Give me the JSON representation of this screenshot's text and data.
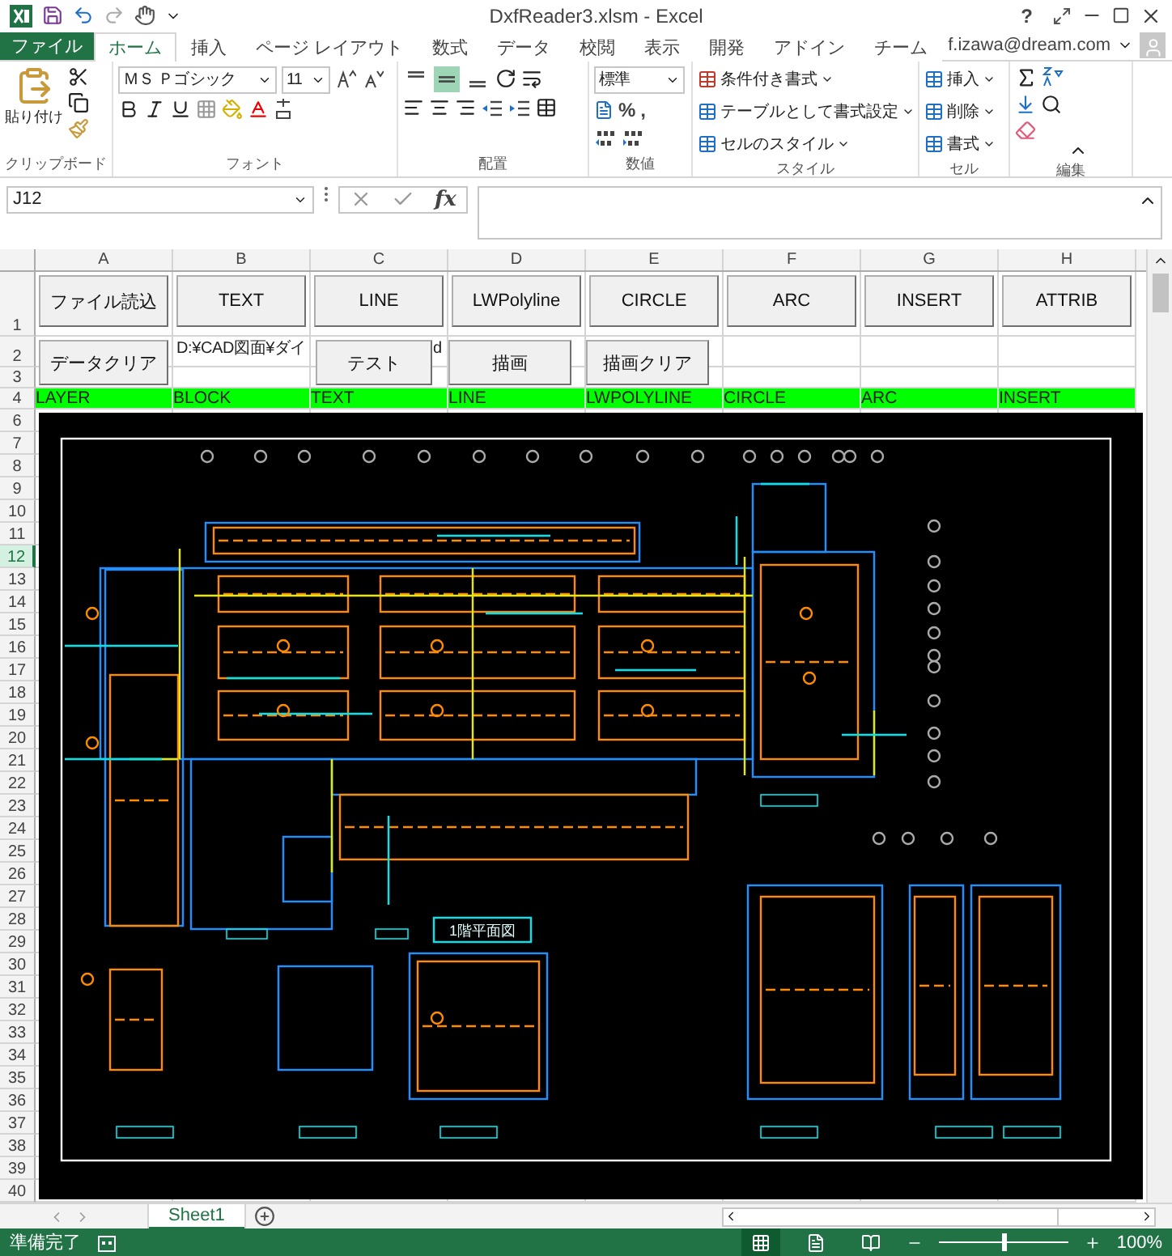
{
  "window": {
    "title": "DxfReader3.xlsm - Excel",
    "help": "?"
  },
  "ribbon_tabs": [
    {
      "label": "ファイル",
      "kind": "file",
      "selected": false
    },
    {
      "label": "ホーム",
      "kind": "tab",
      "selected": true
    },
    {
      "label": "挿入",
      "kind": "tab",
      "selected": false
    },
    {
      "label": "ページ レイアウト",
      "kind": "tab",
      "selected": false
    },
    {
      "label": "数式",
      "kind": "tab",
      "selected": false
    },
    {
      "label": "データ",
      "kind": "tab",
      "selected": false
    },
    {
      "label": "校閲",
      "kind": "tab",
      "selected": false
    },
    {
      "label": "表示",
      "kind": "tab",
      "selected": false
    },
    {
      "label": "開発",
      "kind": "tab",
      "selected": false
    },
    {
      "label": "アドイン",
      "kind": "tab",
      "selected": false
    },
    {
      "label": "チーム",
      "kind": "tab",
      "selected": false
    }
  ],
  "account": {
    "user": "f.izawa@dream.com"
  },
  "ribbon": {
    "clipboard": {
      "paste": "貼り付け",
      "label": "クリップボード"
    },
    "font": {
      "name": "ＭＳ Ｐゴシック",
      "size": "11",
      "label": "フォント"
    },
    "alignment": {
      "vertical": [
        {
          "selected": false
        },
        {
          "selected": true
        },
        {
          "selected": false
        }
      ],
      "label": "配置"
    },
    "number": {
      "format": "標準",
      "percent": "%",
      "comma": ",",
      "label": "数値"
    },
    "styles": {
      "items": [
        "条件付き書式",
        "テーブルとして書式設定",
        "セルのスタイル"
      ],
      "label": "スタイル"
    },
    "cells": {
      "items": [
        "挿入",
        "削除",
        "書式"
      ],
      "label": "セル"
    },
    "editing": {
      "label": "編集"
    }
  },
  "formula_bar": {
    "name_box": "J12",
    "function_glyph": "fx"
  },
  "sheet": {
    "columns": [
      {
        "label": "A",
        "selected": false
      },
      {
        "label": "B",
        "selected": false
      },
      {
        "label": "C",
        "selected": false
      },
      {
        "label": "D",
        "selected": false
      },
      {
        "label": "E",
        "selected": false
      },
      {
        "label": "F",
        "selected": false
      },
      {
        "label": "G",
        "selected": false
      },
      {
        "label": "H",
        "selected": false
      }
    ],
    "rows": [
      {
        "label": "1",
        "selected": false
      },
      {
        "label": "2",
        "selected": false
      },
      {
        "label": "3",
        "selected": false
      },
      {
        "label": "4",
        "selected": false
      },
      {
        "label": "6",
        "selected": false
      },
      {
        "label": "7",
        "selected": false
      },
      {
        "label": "8",
        "selected": false
      },
      {
        "label": "9",
        "selected": false
      },
      {
        "label": "10",
        "selected": false
      },
      {
        "label": "11",
        "selected": false
      },
      {
        "label": "12",
        "selected": true
      },
      {
        "label": "13",
        "selected": false
      },
      {
        "label": "14",
        "selected": false
      },
      {
        "label": "15",
        "selected": false
      },
      {
        "label": "16",
        "selected": false
      },
      {
        "label": "17",
        "selected": false
      },
      {
        "label": "18",
        "selected": false
      },
      {
        "label": "19",
        "selected": false
      },
      {
        "label": "20",
        "selected": false
      },
      {
        "label": "21",
        "selected": false
      },
      {
        "label": "22",
        "selected": false
      },
      {
        "label": "23",
        "selected": false
      },
      {
        "label": "24",
        "selected": false
      },
      {
        "label": "25",
        "selected": false
      },
      {
        "label": "26",
        "selected": false
      },
      {
        "label": "27",
        "selected": false
      },
      {
        "label": "28",
        "selected": false
      },
      {
        "label": "29",
        "selected": false
      },
      {
        "label": "30",
        "selected": false
      },
      {
        "label": "31",
        "selected": false
      },
      {
        "label": "32",
        "selected": false
      },
      {
        "label": "33",
        "selected": false
      },
      {
        "label": "34",
        "selected": false
      },
      {
        "label": "35",
        "selected": false
      },
      {
        "label": "36",
        "selected": false
      },
      {
        "label": "37",
        "selected": false
      },
      {
        "label": "38",
        "selected": false
      },
      {
        "label": "39",
        "selected": false
      },
      {
        "label": "40",
        "selected": false
      }
    ],
    "buttons_row1": [
      "ファイル読込",
      "TEXT",
      "LINE",
      "LWPolyline",
      "CIRCLE",
      "ARC",
      "INSERT",
      "ATTRIB"
    ],
    "buttons_row2": [
      "データクリア",
      "テスト",
      "描画",
      "描画クリア"
    ],
    "b2_text": "D:¥CAD図面¥ダイ",
    "c2_text": "d",
    "row4_labels": [
      "LAYER",
      "BLOCK",
      "TEXT",
      "LINE",
      "LWPOLYLINE",
      "CIRCLE",
      "ARC",
      "INSERT"
    ],
    "plan_title": "1階平面図"
  },
  "sheet_tabs": [
    {
      "label": "Sheet1",
      "selected": true
    }
  ],
  "status_bar": {
    "text": "準備完了",
    "views": [
      {
        "selected": true
      },
      {
        "selected": false
      },
      {
        "selected": false
      }
    ],
    "zoom": {
      "level": 0.5,
      "reading": "100%"
    }
  }
}
